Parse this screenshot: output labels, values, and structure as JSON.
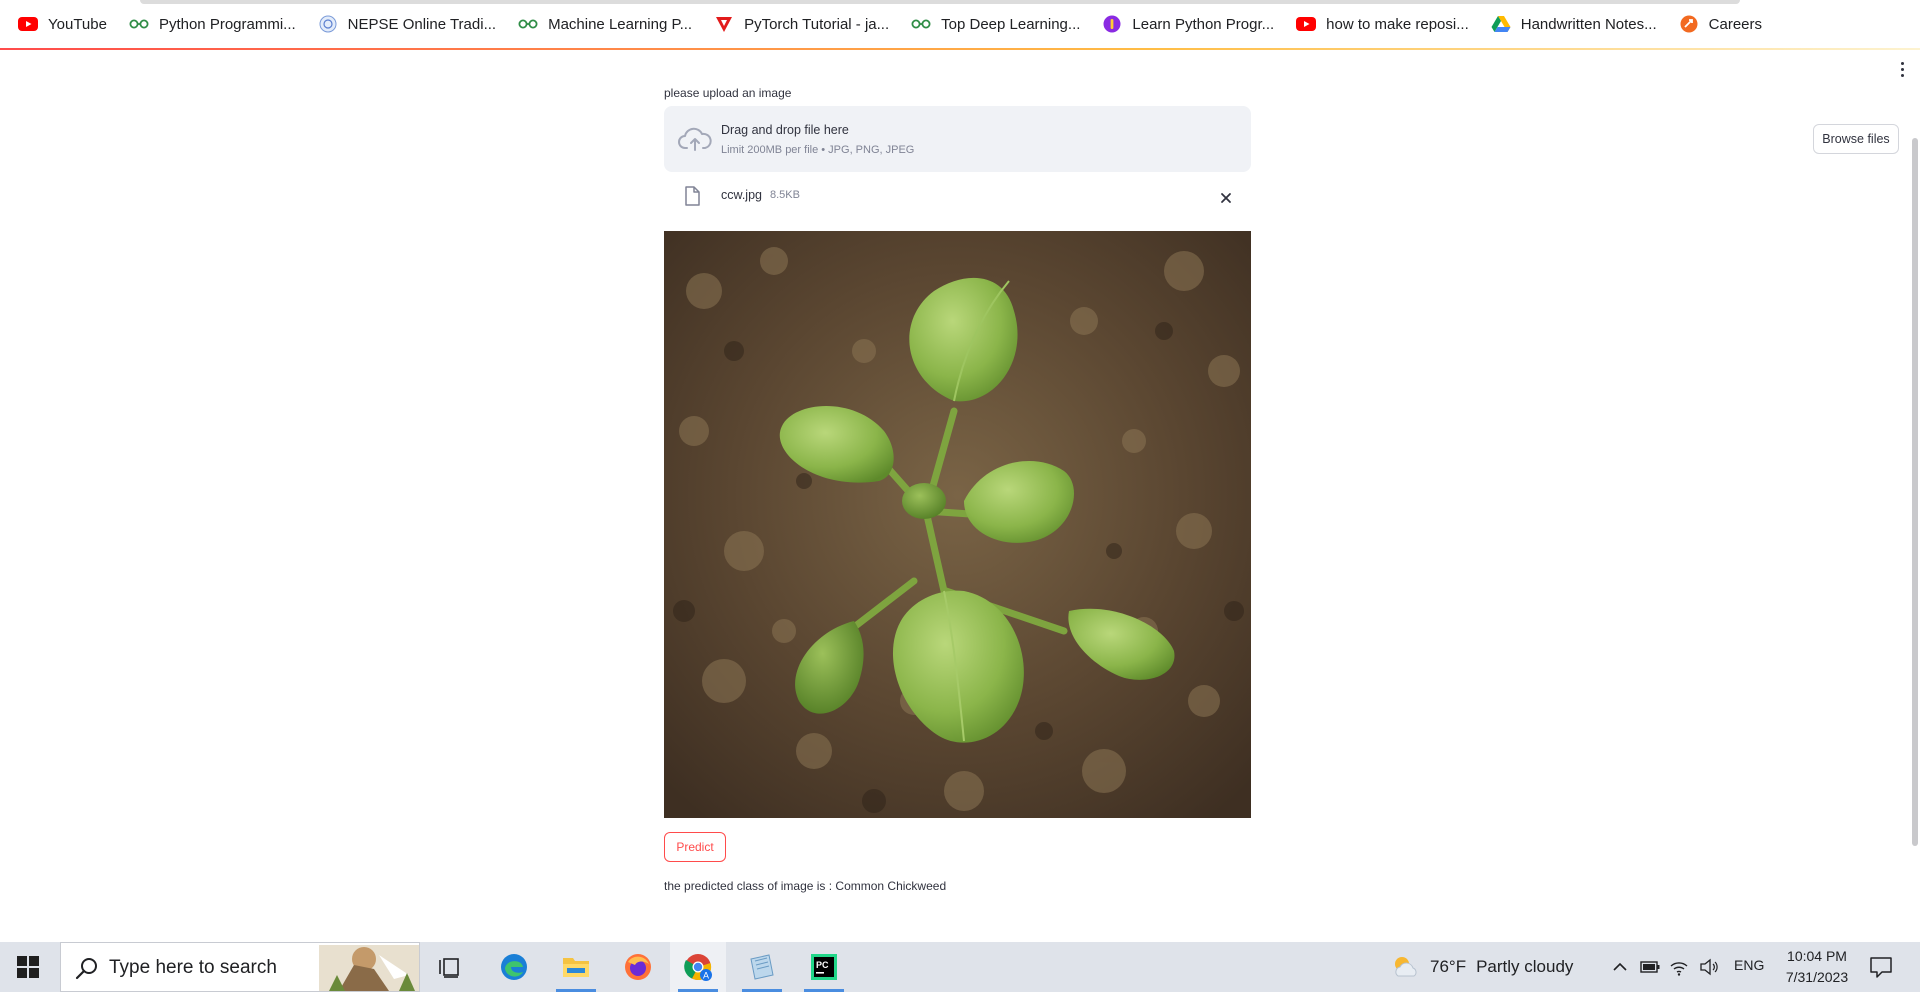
{
  "bookmarks": [
    {
      "label": "YouTube",
      "icon": "youtube-icon"
    },
    {
      "label": "Python Programmi...",
      "icon": "geeksforgeeks-icon"
    },
    {
      "label": "NEPSE Online Tradi...",
      "icon": "nepse-icon"
    },
    {
      "label": "Machine Learning P...",
      "icon": "geeksforgeeks-icon"
    },
    {
      "label": "PyTorch Tutorial - ja...",
      "icon": "javatpoint-icon"
    },
    {
      "label": "Top Deep Learning...",
      "icon": "geeksforgeeks-icon"
    },
    {
      "label": "Learn Python Progr...",
      "icon": "programiz-icon"
    },
    {
      "label": "how to make reposi...",
      "icon": "youtube-icon"
    },
    {
      "label": "Handwritten Notes...",
      "icon": "google-drive-icon"
    },
    {
      "label": "Careers",
      "icon": "careers-icon"
    }
  ],
  "uploader": {
    "label": "please upload an image",
    "drop_title": "Drag and drop file here",
    "drop_limit": "Limit 200MB per file • JPG, PNG, JPEG",
    "browse_label": "Browse files",
    "file_name": "ccw.jpg",
    "file_size": "8.5KB"
  },
  "image_alt": "uploaded seedling photo",
  "predict_label": "Predict",
  "result_text": "the predicted class of image is : Common Chickweed",
  "taskbar": {
    "search_placeholder": "Type here to search",
    "weather_temp": "76°F",
    "weather_desc": "Partly cloudy",
    "language": "ENG",
    "time": "10:04 PM",
    "date": "7/31/2023"
  },
  "colors": {
    "accent": "#ff4b4b",
    "dropzone_bg": "#f0f2f6",
    "taskbar_bg": "#dfe3ea"
  }
}
